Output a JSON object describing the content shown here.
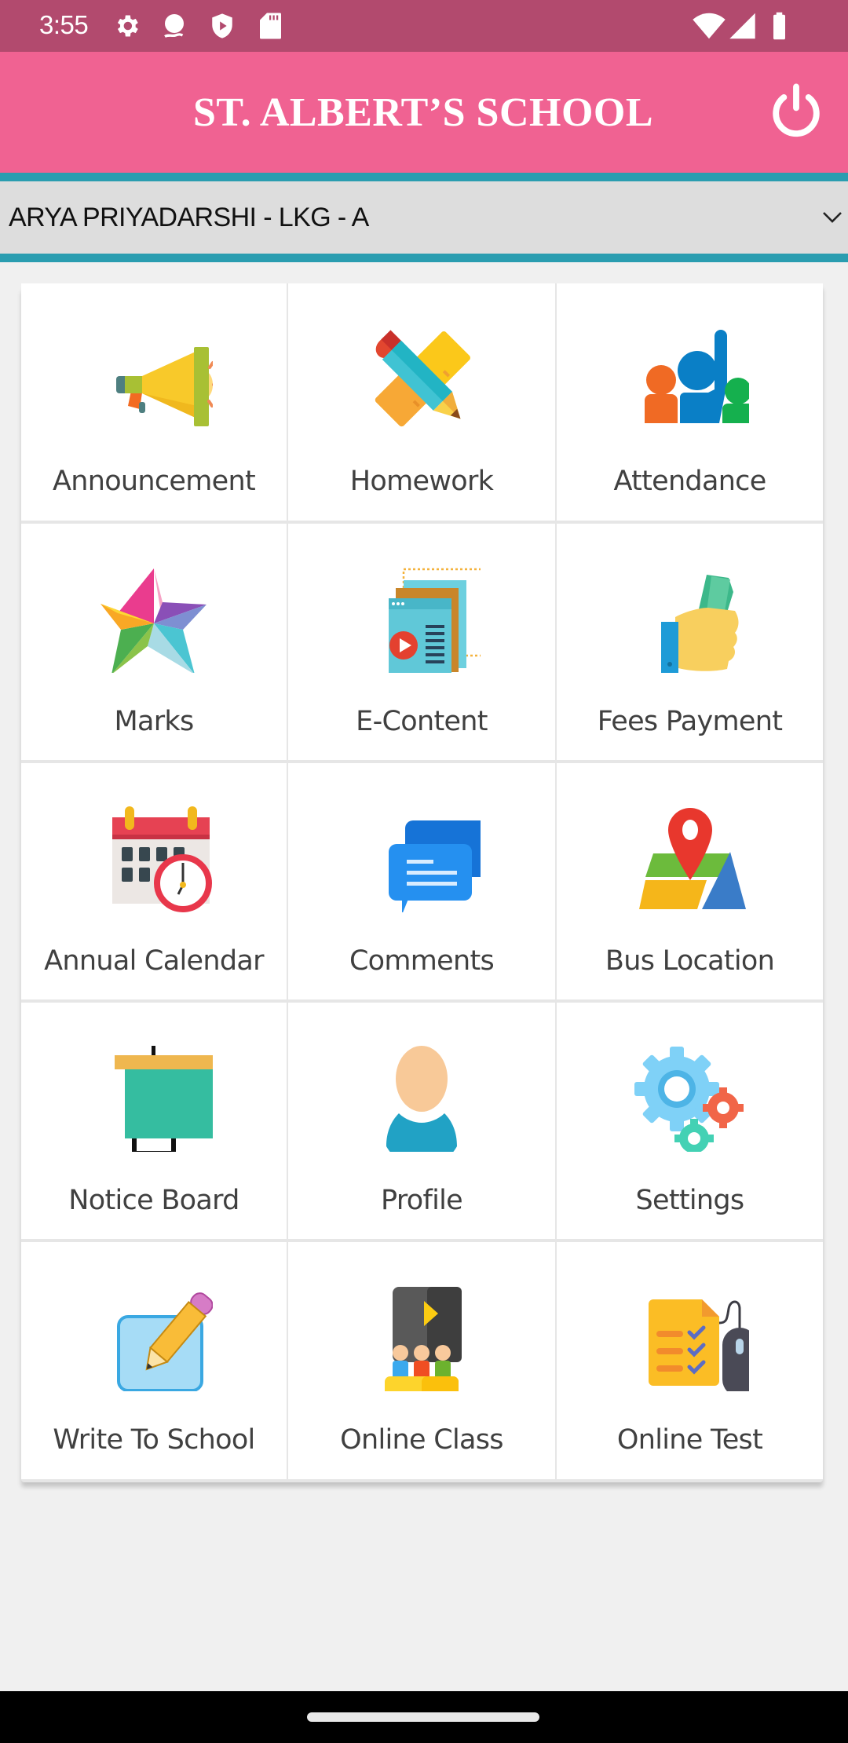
{
  "status_bar": {
    "time": "3:55",
    "left_icons": [
      "settings-icon",
      "assistant-bubble-icon",
      "shield-play-icon",
      "sd-card-icon"
    ],
    "right_icons": [
      "wifi-icon",
      "cellular-signal-icon",
      "battery-icon"
    ]
  },
  "header": {
    "title": "ST. ALBERT’S SCHOOL",
    "logout_icon": "power-icon"
  },
  "student_selector": {
    "selected": "ARYA PRIYADARSHI - LKG - A",
    "icon": "chevron-down-icon"
  },
  "menu": {
    "items": [
      {
        "label": "Announcement",
        "icon": "megaphone-icon"
      },
      {
        "label": "Homework",
        "icon": "pencil-ruler-icon"
      },
      {
        "label": "Attendance",
        "icon": "raised-hand-people-icon"
      },
      {
        "label": "Marks",
        "icon": "star-icon"
      },
      {
        "label": "E-Content",
        "icon": "video-document-icon"
      },
      {
        "label": "Fees Payment",
        "icon": "hand-money-icon"
      },
      {
        "label": "Annual Calendar",
        "icon": "calendar-clock-icon"
      },
      {
        "label": "Comments",
        "icon": "chat-bubbles-icon"
      },
      {
        "label": "Bus Location",
        "icon": "map-pin-icon"
      },
      {
        "label": "Notice Board",
        "icon": "easel-board-icon"
      },
      {
        "label": "Profile",
        "icon": "user-icon"
      },
      {
        "label": "Settings",
        "icon": "gears-icon"
      },
      {
        "label": "Write To School",
        "icon": "note-pencil-icon"
      },
      {
        "label": "Online Class",
        "icon": "class-video-icon"
      },
      {
        "label": "Online Test",
        "icon": "checklist-mouse-icon"
      }
    ]
  },
  "colors": {
    "status_bar": "#b24a6e",
    "header": "#f06292",
    "accent_teal": "#2a9db0",
    "selector_bg": "#dddddd",
    "page_bg": "#f0f0f0",
    "label_text": "#404040"
  }
}
